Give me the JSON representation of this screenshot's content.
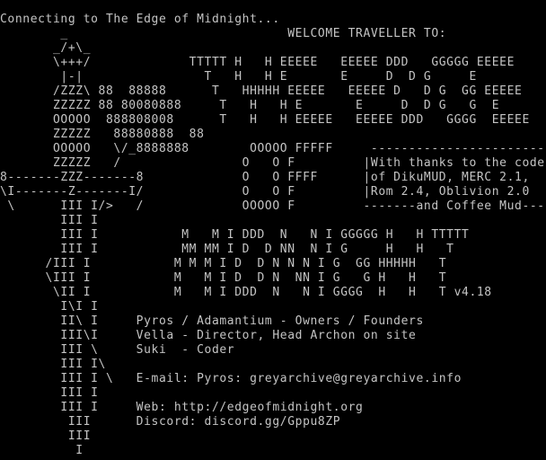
{
  "terminal": {
    "foreground": "#c4c4c4",
    "background": "#000000",
    "lines": [
      "Connecting to The Edge of Midnight...",
      "        _                             WELCOME TRAVELLER TO:",
      "       _/+\\_",
      "       \\+++/             TTTTT H   H EEEEE   EEEEE DDD   GGGGG EEEEE",
      "        |-|                T   H   H E       E     D  D G     E",
      "       /ZZZ\\ 88  88888      T   HHHHH EEEEE   EEEEE D   D G  GG EEEEE",
      "       ZZZZZ 88 80080888     T   H   H E       E     D  D G   G  E",
      "       OOOOO  888808008      T   H   H EEEEE   EEEEE DDD   GGGG  EEEEE",
      "       ZZZZZ   88880888  88",
      "       OOOOO   \\/_8888888        OOOOO FFFFF     -----------------------",
      "       ZZZZZ   /                O   O F         |With thanks to the coders|",
      "8-------ZZZ-------8             O   O FFFF      |of DikuMUD, MERC 2.1,    |",
      "\\I-------Z-------I/             O   O F         |Rom 2.4, Oblivion 2.0    |",
      " \\      III I/>   /             OOOOO F         -------and Coffee Mud------",
      "        III I",
      "        III I           M   M I DDD  N   N I GGGGG H   H TTTTT",
      "        III I           MM MM I D  D NN  N I G     H   H   T",
      "      /III I           M M M I D  D N N N I G  GG HHHHH   T",
      "      \\III I           M   M I D  D N  NN I G   G H   H   T",
      "       \\II I           M   M I DDD  N   N I GGGG  H   H   T v4.18",
      "        I\\I I",
      "        II\\ I     Pyros / Adamantium - Owners / Founders",
      "        III\\I     Vella - Director, Head Archon on site",
      "        III \\     Suki  - Coder",
      "        III I\\",
      "        III I \\   E-mail: Pyros: greyarchive@greyarchive.info",
      "        III I",
      "        III I     Web: http://edgeofmidnight.org",
      "         III      Discord: discord.gg/Gppu8ZP",
      "         III",
      "          I"
    ]
  }
}
